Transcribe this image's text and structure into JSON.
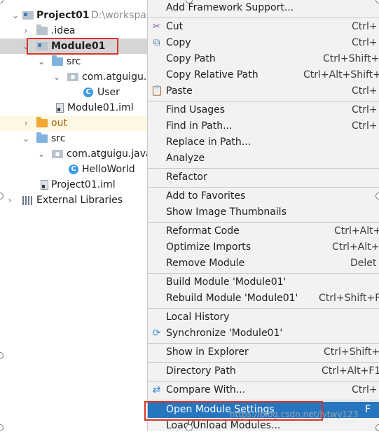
{
  "tree": {
    "project_name": "Project01",
    "project_path": "D:\\workspa",
    "idea": ".idea",
    "module": "Module01",
    "module_src": "src",
    "module_package": "com.atguigu.b",
    "module_class": "User",
    "module_iml": "Module01.iml",
    "out": "out",
    "src": "src",
    "package": "com.atguigu.java",
    "class": "HelloWorld",
    "project_iml": "Project01.iml",
    "external_libraries": "External Libraries"
  },
  "menu": {
    "add_framework": "Add Framework Support...",
    "cut": "Cut",
    "cut_sc": "Ctrl+",
    "copy": "Copy",
    "copy_sc": "Ctrl+",
    "copy_path": "Copy Path",
    "copy_path_sc": "Ctrl+Shift+",
    "copy_relative_path": "Copy Relative Path",
    "copy_relative_path_sc": "Ctrl+Alt+Shift+",
    "paste": "Paste",
    "paste_sc": "Ctrl+",
    "find_usages": "Find Usages",
    "find_usages_sc": "Ctrl+",
    "find_in_path": "Find in Path...",
    "find_in_path_sc": "Ctrl+",
    "replace_in_path": "Replace in Path...",
    "analyze": "Analyze",
    "refactor": "Refactor",
    "add_to_favorites": "Add to Favorites",
    "show_image_thumbnails": "Show Image Thumbnails",
    "reformat_code": "Reformat Code",
    "reformat_code_sc": "Ctrl+Alt+",
    "optimize_imports": "Optimize Imports",
    "optimize_imports_sc": "Ctrl+Alt+",
    "remove_module": "Remove Module",
    "remove_module_sc": "Delet",
    "build_module": "Build Module 'Module01'",
    "rebuild_module": "Rebuild Module 'Module01'",
    "rebuild_module_sc": "Ctrl+Shift+F",
    "local_history": "Local History",
    "synchronize": "Synchronize 'Module01'",
    "show_in_explorer": "Show in Explorer",
    "show_in_explorer_sc": "Ctrl+Shift+",
    "directory_path": "Directory Path",
    "directory_path_sc": "Ctrl+Alt+F1",
    "compare_with": "Compare With...",
    "compare_with_sc": "Ctrl+",
    "open_module_settings": "Open Module Settings",
    "open_module_settings_sc": "F",
    "load_unload_modules": "Load/Unload Modules..."
  },
  "watermark": "https://blog.csdn.net/lytwy123",
  "colors": {
    "highlight_box": "#d9342b",
    "active_item": "#2675bf",
    "menu_bg": "#f2f2f2",
    "selected_row": "#d5d5d5"
  }
}
